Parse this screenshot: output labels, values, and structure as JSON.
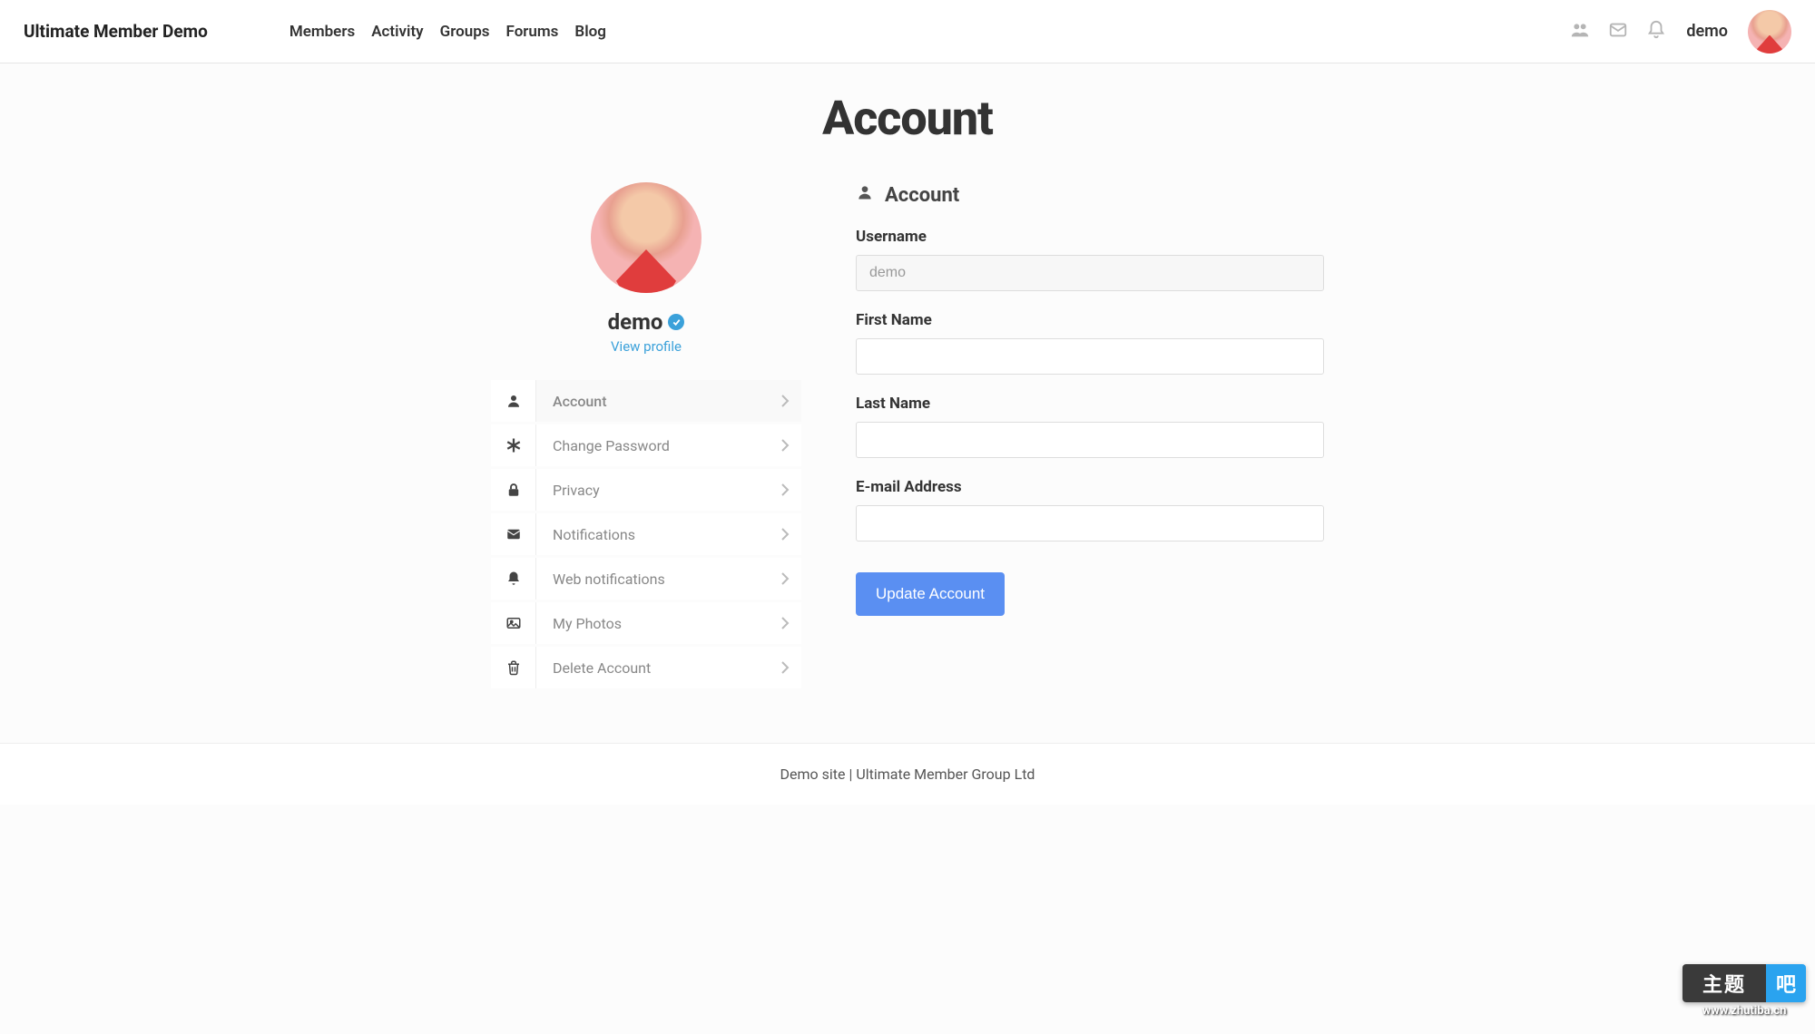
{
  "header": {
    "site_title": "Ultimate Member Demo",
    "nav": [
      "Members",
      "Activity",
      "Groups",
      "Forums",
      "Blog"
    ],
    "user_name": "demo"
  },
  "page": {
    "title": "Account"
  },
  "profile": {
    "name": "demo",
    "view_profile": "View profile"
  },
  "tabs": [
    {
      "icon": "user",
      "label": "Account"
    },
    {
      "icon": "asterisk",
      "label": "Change Password"
    },
    {
      "icon": "lock",
      "label": "Privacy"
    },
    {
      "icon": "envelope",
      "label": "Notifications"
    },
    {
      "icon": "bell",
      "label": "Web notifications"
    },
    {
      "icon": "image",
      "label": "My Photos"
    },
    {
      "icon": "trash",
      "label": "Delete Account"
    }
  ],
  "form": {
    "section_title": "Account",
    "fields": {
      "username": {
        "label": "Username",
        "value": "demo",
        "disabled": true
      },
      "first_name": {
        "label": "First Name",
        "value": ""
      },
      "last_name": {
        "label": "Last Name",
        "value": ""
      },
      "email": {
        "label": "E-mail Address",
        "value": ""
      }
    },
    "submit": "Update Account"
  },
  "footer": {
    "text": "Demo site | Ultimate Member Group Ltd"
  },
  "watermark": {
    "left": "主题",
    "right": "吧",
    "url": "www.zhutiba.cn"
  }
}
